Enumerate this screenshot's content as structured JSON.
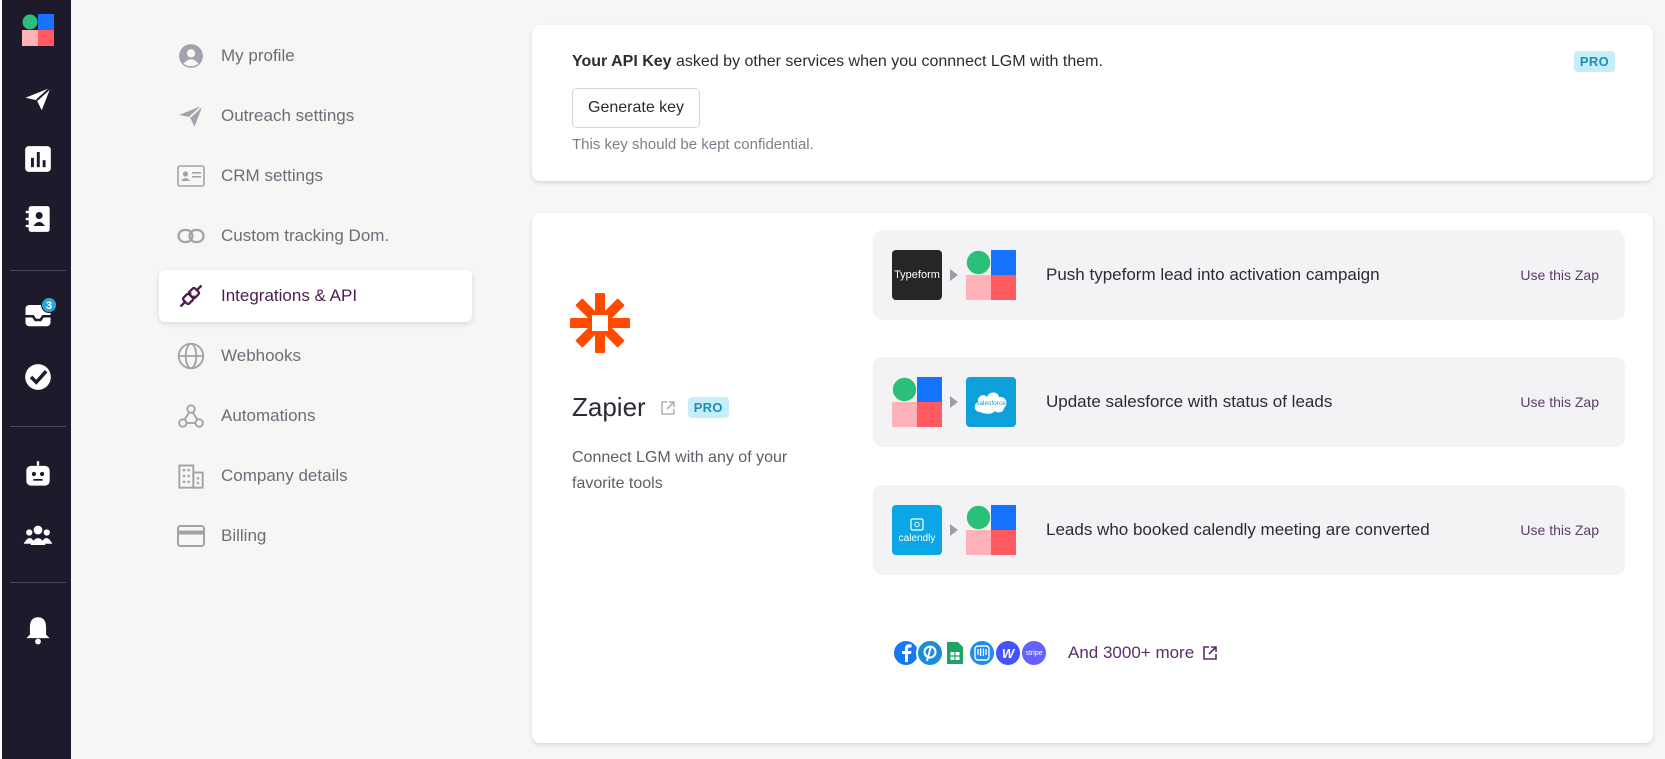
{
  "rail": {
    "inbox_badge": "3"
  },
  "settings_nav": {
    "items": [
      {
        "label": "My profile",
        "icon": "user-icon"
      },
      {
        "label": "Outreach settings",
        "icon": "send-icon"
      },
      {
        "label": "CRM settings",
        "icon": "id-card-icon"
      },
      {
        "label": "Custom tracking Dom.",
        "icon": "link-icon"
      },
      {
        "label": "Integrations & API",
        "icon": "plug-icon",
        "active": true
      },
      {
        "label": "Webhooks",
        "icon": "globe-icon"
      },
      {
        "label": "Automations",
        "icon": "webhook-icon"
      },
      {
        "label": "Company details",
        "icon": "building-icon"
      },
      {
        "label": "Billing",
        "icon": "credit-card-icon"
      }
    ]
  },
  "api": {
    "title_bold": "Your API Key",
    "title_rest": " asked by other services when you connnect LGM with them.",
    "pro": "PRO",
    "button": "Generate key",
    "note": "This key should be kept confidential."
  },
  "zapier": {
    "name": "Zapier",
    "pro": "PRO",
    "description": "Connect LGM with any of your favorite tools",
    "zaps": [
      {
        "app": "Typeform",
        "label": "Push typeform lead into activation campaign",
        "action": "Use this Zap"
      },
      {
        "app": "salesforce",
        "label": "Update salesforce with status of leads",
        "action": "Use this Zap"
      },
      {
        "app": "calendly",
        "label": "Leads who booked calendly meeting are converted",
        "action": "Use this Zap"
      }
    ],
    "more_label": "And 3000+ more",
    "more_icons": [
      "facebook-icon",
      "pipedrive-icon",
      "google-sheets-icon",
      "intercom-icon",
      "webflow-icon",
      "stripe-icon"
    ],
    "stripe_text": "stripe"
  },
  "colors": {
    "rail_bg": "#1e1a2c",
    "accent": "#4b1e4f",
    "zapier": "#ff4a00",
    "pro_bg": "#c6eef8"
  }
}
